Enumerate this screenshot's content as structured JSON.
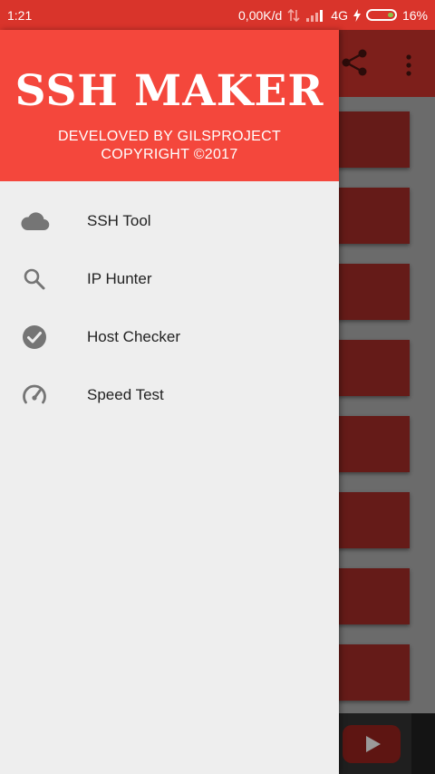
{
  "status_bar": {
    "time": "1:21",
    "network_speed": "0,00K/d",
    "network_type": "4G",
    "battery": "16%",
    "battery_color": "#8bc34a"
  },
  "drawer": {
    "title": "SSH MAKER",
    "credit": "DEVELOVED BY GILSPROJECT",
    "copyright": "COPYRIGHT ©2017",
    "header_color": "#f4473c",
    "items": [
      {
        "label": "SSH Tool",
        "icon": "cloud-icon"
      },
      {
        "label": "IP Hunter",
        "icon": "search-icon"
      },
      {
        "label": "Host Checker",
        "icon": "check-circle-icon"
      },
      {
        "label": "Speed Test",
        "icon": "speedometer-icon"
      }
    ]
  },
  "background_app": {
    "toolbar_icons": [
      "share-icon",
      "overflow-menu-icon"
    ],
    "bottom_icon": "play-icon"
  }
}
